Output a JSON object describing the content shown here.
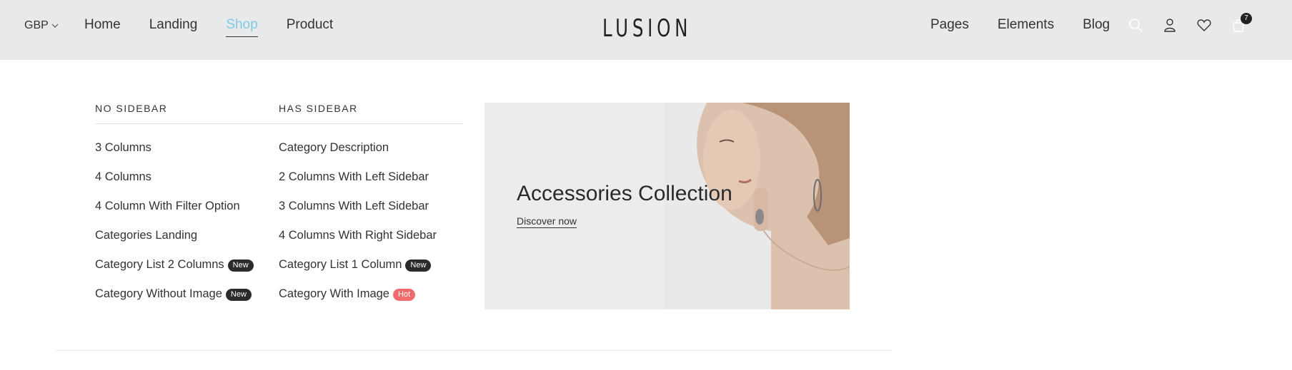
{
  "header": {
    "currency": "GBP",
    "nav_left": [
      "Home",
      "Landing",
      "Shop",
      "Product"
    ],
    "active_nav": "Shop",
    "logo": "LUSION",
    "nav_right": [
      "Pages",
      "Elements",
      "Blog"
    ],
    "icons": [
      "search-icon",
      "user-icon",
      "heart-icon",
      "cart-icon"
    ],
    "cart_count": "7",
    "active_color": "#7fcbe3"
  },
  "mega_menu": {
    "columns": [
      {
        "heading": "NO SIDEBAR",
        "items": [
          {
            "label": "3 Columns",
            "badge": ""
          },
          {
            "label": "4 Columns",
            "badge": ""
          },
          {
            "label": "4 Column With Filter Option",
            "badge": ""
          },
          {
            "label": "Categories Landing",
            "badge": ""
          },
          {
            "label": "Category List 2 Columns",
            "badge": "New"
          },
          {
            "label": "Category Without Image",
            "badge": "New"
          }
        ]
      },
      {
        "heading": "HAS SIDEBAR",
        "items": [
          {
            "label": "Category Description",
            "badge": ""
          },
          {
            "label": "2 Columns With Left Sidebar",
            "badge": ""
          },
          {
            "label": "3 Columns With Left Sidebar",
            "badge": ""
          },
          {
            "label": "4 Columns With Right Sidebar",
            "badge": ""
          },
          {
            "label": "Category List 1 Column",
            "badge": "New"
          },
          {
            "label": "Category With Image",
            "badge": "Hot"
          }
        ]
      }
    ],
    "banner": {
      "title": "Accessories Collection",
      "link": "Discover now"
    },
    "badge_colors": {
      "New": "#2b2b2b",
      "Hot": "#f06b6b"
    }
  }
}
